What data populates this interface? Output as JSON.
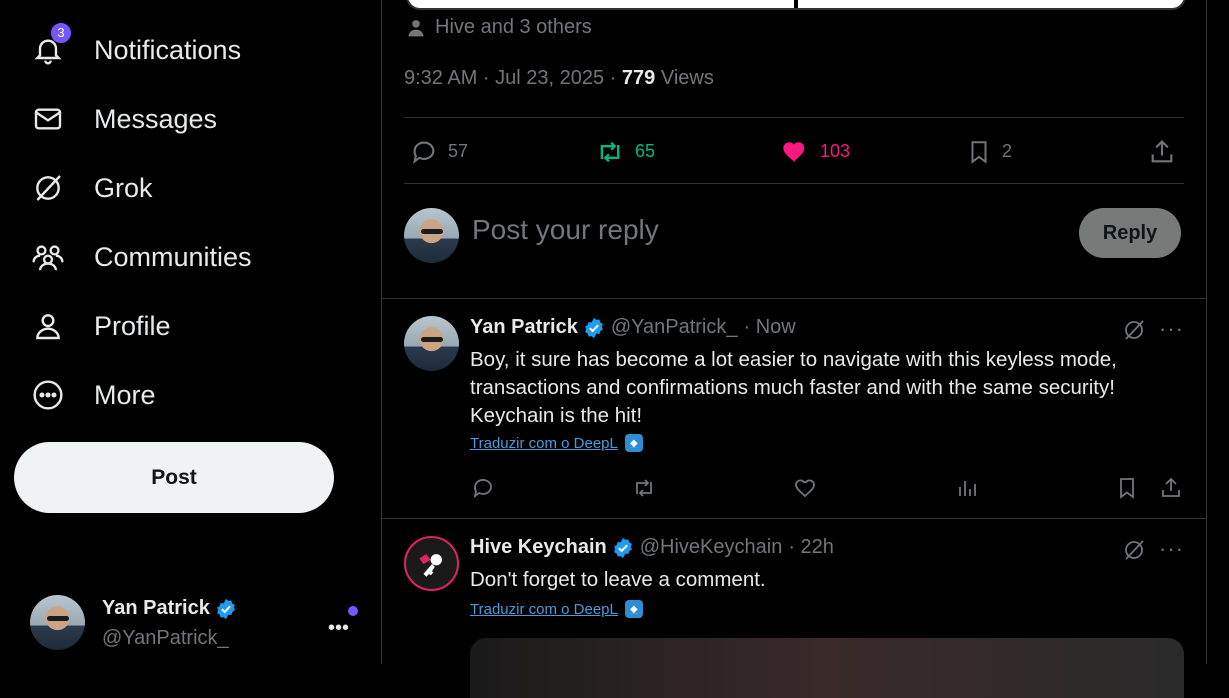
{
  "sidebar": {
    "items": [
      {
        "label": "Notifications",
        "icon": "bell-icon",
        "badge": "3"
      },
      {
        "label": "Messages",
        "icon": "envelope-icon"
      },
      {
        "label": "Grok",
        "icon": "grok-icon"
      },
      {
        "label": "Communities",
        "icon": "communities-icon"
      },
      {
        "label": "Profile",
        "icon": "person-icon"
      },
      {
        "label": "More",
        "icon": "more-circle-icon"
      }
    ],
    "post_label": "Post",
    "account": {
      "name": "Yan Patrick",
      "handle": "@YanPatrick_",
      "more": "•••"
    }
  },
  "post": {
    "tagged": "Hive and 3 others",
    "time": "9:32 AM · Jul 23, 2025 · ",
    "views_count": "779",
    "views_label": " Views",
    "stats": {
      "replies": "57",
      "reposts": "65",
      "likes": "103",
      "bookmarks": "2"
    }
  },
  "composer": {
    "placeholder": "Post your reply",
    "reply_label": "Reply"
  },
  "replies": [
    {
      "name": "Yan Patrick",
      "handle": "@YanPatrick_",
      "time": "· Now",
      "text": "Boy, it sure has become a lot easier to navigate with this keyless mode, transactions and confirmations much faster and with the same security! Keychain is the hit!",
      "translate": "Traduzir com o DeepL"
    },
    {
      "name": "Hive Keychain",
      "handle": "@HiveKeychain",
      "time": "· 22h",
      "text": "Don't forget to leave a comment.",
      "translate": "Traduzir com o DeepL"
    }
  ],
  "colors": {
    "accent": "#1d9bf0",
    "like": "#f91880",
    "repost": "#00ba7c",
    "badge": "#7856ff"
  }
}
